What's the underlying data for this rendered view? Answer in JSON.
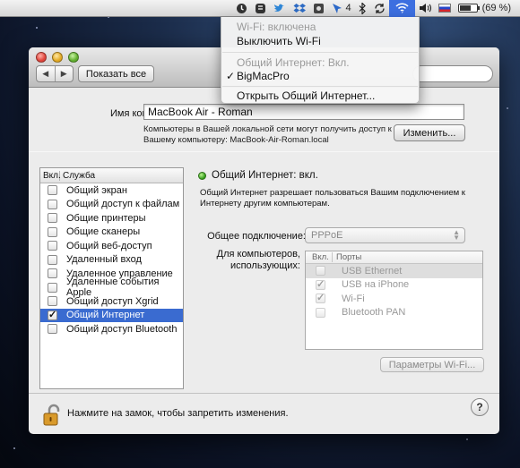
{
  "menubar": {
    "battery_text": "(69 %)",
    "badge_count": "4",
    "icons": [
      "backup-icon",
      "evernote-icon",
      "twitter-icon",
      "dropbox-icon",
      "settings-icon",
      "cursor-icon",
      "bluetooth-icon",
      "sync-icon",
      "wifi-icon",
      "volume-icon",
      "flag-icon",
      "battery-icon"
    ],
    "battery_level": 0.69
  },
  "wifi_menu": {
    "status": "Wi-Fi: включена",
    "toggle": "Выключить Wi-Fi",
    "sharing_status": "Общий Интернет: Вкл.",
    "network": "BigMacPro",
    "open_sharing": "Открыть Общий Интернет..."
  },
  "window": {
    "show_all": "Показать все",
    "nav_back": "◀",
    "nav_forward": "▶",
    "computer_name_label": "Имя компьютера:",
    "computer_name_value": "MacBook Air - Roman",
    "computer_name_note": "Компьютеры в Вашей локальной сети могут получить доступ к Вашему компьютеру: MacBook-Air-Roman.local",
    "change_button": "Изменить...",
    "services_header_on": "Вкл.",
    "services_header_service": "Служба",
    "services": [
      {
        "label": "Общий экран",
        "checked": false
      },
      {
        "label": "Общий доступ к файлам",
        "checked": false
      },
      {
        "label": "Общие принтеры",
        "checked": false
      },
      {
        "label": "Общие сканеры",
        "checked": false
      },
      {
        "label": "Общий веб-доступ",
        "checked": false
      },
      {
        "label": "Удаленный вход",
        "checked": false
      },
      {
        "label": "Удаленное управление",
        "checked": false
      },
      {
        "label": "Удаленные события Apple",
        "checked": false
      },
      {
        "label": "Общий доступ Xgrid",
        "checked": false
      },
      {
        "label": "Общий Интернет",
        "checked": true
      },
      {
        "label": "Общий доступ Bluetooth",
        "checked": false
      }
    ],
    "status_title": "Общий Интернет: вкл.",
    "status_description": "Общий Интернет разрешает пользоваться Вашим подключением к Интернету другим компьютерам.",
    "share_connection_label": "Общее подключение:",
    "share_connection_value": "PPPoE",
    "for_computers_label": "Для компьютеров, использующих:",
    "ports_header_on": "Вкл.",
    "ports_header_ports": "Порты",
    "ports": [
      {
        "label": "USB Ethernet",
        "checked": false
      },
      {
        "label": "USB на iPhone",
        "checked": true
      },
      {
        "label": "Wi-Fi",
        "checked": true
      },
      {
        "label": "Bluetooth PAN",
        "checked": false
      }
    ],
    "wifi_params_button": "Параметры Wi-Fi...",
    "lock_text": "Нажмите на замок, чтобы запретить изменения.",
    "help": "?"
  }
}
